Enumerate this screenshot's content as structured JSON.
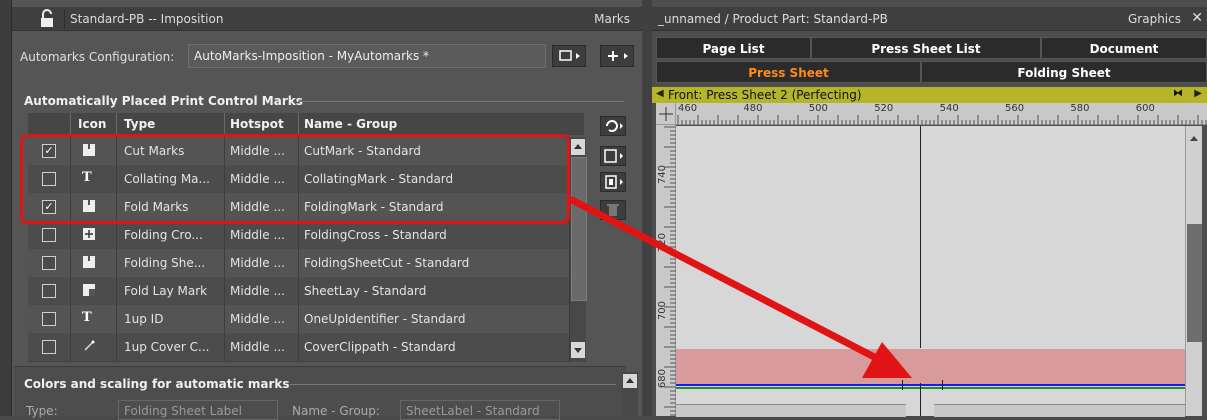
{
  "left_panel": {
    "title": "Standard-PB -- Imposition",
    "title_right": "Marks",
    "config_label": "Automarks Configuration:",
    "config_value": "AutoMarks-Imposition - MyAutomarks *",
    "section1_title": "Automatically Placed Print Control Marks",
    "columns": [
      "Icon",
      "Type",
      "Hotspot",
      "Name - Group"
    ],
    "rows": [
      {
        "checked": true,
        "icon": "cut-mark-icon",
        "type": "Cut Marks",
        "hotspot": "Middle ...",
        "name": "CutMark - Standard"
      },
      {
        "checked": false,
        "icon": "text-t-icon",
        "icon_glyph": "T",
        "type": "Collating Ma...",
        "hotspot": "Middle ...",
        "name": "CollatingMark - Standard"
      },
      {
        "checked": true,
        "icon": "fold-mark-icon",
        "type": "Fold Marks",
        "hotspot": "Middle ...",
        "name": "FoldingMark - Standard"
      },
      {
        "checked": false,
        "icon": "folding-cross-icon",
        "type": "Folding Cro...",
        "hotspot": "Middle ...",
        "name": "FoldingCross - Standard"
      },
      {
        "checked": false,
        "icon": "folding-sheet-icon",
        "type": "Folding She...",
        "hotspot": "Middle ...",
        "name": "FoldingSheetCut - Standard"
      },
      {
        "checked": false,
        "icon": "fold-lay-icon",
        "type": "Fold Lay Mark",
        "hotspot": "Middle ...",
        "name": "SheetLay - Standard"
      },
      {
        "checked": false,
        "icon": "text-t-icon",
        "icon_glyph": "T",
        "type": "1up ID",
        "hotspot": "Middle ...",
        "name": "OneUpIdentifier - Standard"
      },
      {
        "checked": false,
        "icon": "magic-wand-icon",
        "type": "1up Cover C...",
        "hotspot": "Middle ...",
        "name": "CoverClippath - Standard"
      }
    ],
    "section2_title": "Colors and scaling for automatic marks",
    "type_label": "Type:",
    "type_value": "Folding Sheet Label",
    "name_group_label": "Name - Group:",
    "name_group_value": "SheetLabel - Standard"
  },
  "right_panel": {
    "title": "_unnamed / Product Part: Standard-PB",
    "title_right": "Graphics",
    "tabs_row1": [
      "Page List",
      "Press Sheet List",
      "Document"
    ],
    "tabs_row2": [
      "Press Sheet",
      "Folding Sheet"
    ],
    "sheet_label": "Front:  Press Sheet 2 (Perfecting)",
    "hruler": [
      "460",
      "480",
      "500",
      "520",
      "540",
      "560",
      "580",
      "600"
    ],
    "vruler": [
      "740",
      "720",
      "700",
      "680"
    ]
  },
  "colors": {
    "highlight": "#e01414",
    "active_tab": "#ff8c1a",
    "sheet_bar": "#b5b52a"
  }
}
